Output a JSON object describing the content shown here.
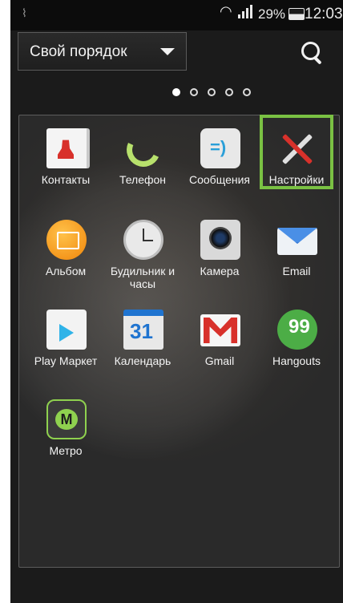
{
  "status_bar": {
    "battery_percent": "29%",
    "time": "12:03",
    "icons": [
      "cast-icon",
      "wifi-icon",
      "signal-icon",
      "battery-icon"
    ]
  },
  "header": {
    "sort_label": "Свой порядок",
    "search_icon": "search-icon"
  },
  "pager": {
    "pages": 5,
    "active_page": 1
  },
  "apps": [
    {
      "name": "contacts",
      "label": "Контакты",
      "icon": "contacts-icon"
    },
    {
      "name": "phone",
      "label": "Телефон",
      "icon": "phone-icon"
    },
    {
      "name": "messages",
      "label": "Сообщения",
      "icon": "messages-icon"
    },
    {
      "name": "settings",
      "label": "Настройки",
      "icon": "settings-icon",
      "highlighted": true
    },
    {
      "name": "album",
      "label": "Альбом",
      "icon": "album-icon"
    },
    {
      "name": "alarm-clock",
      "label": "Будильник и часы",
      "icon": "clock-icon"
    },
    {
      "name": "camera",
      "label": "Камера",
      "icon": "camera-icon"
    },
    {
      "name": "email",
      "label": "Email",
      "icon": "email-icon"
    },
    {
      "name": "play-market",
      "label": "Play Маркет",
      "icon": "play-store-icon"
    },
    {
      "name": "calendar",
      "label": "Календарь",
      "icon": "calendar-icon"
    },
    {
      "name": "gmail",
      "label": "Gmail",
      "icon": "gmail-icon"
    },
    {
      "name": "hangouts",
      "label": "Hangouts",
      "icon": "hangouts-icon"
    },
    {
      "name": "metro",
      "label": "Метро",
      "icon": "metro-icon"
    }
  ],
  "colors": {
    "highlight": "#7ac143",
    "background": "#1b1b1b"
  }
}
